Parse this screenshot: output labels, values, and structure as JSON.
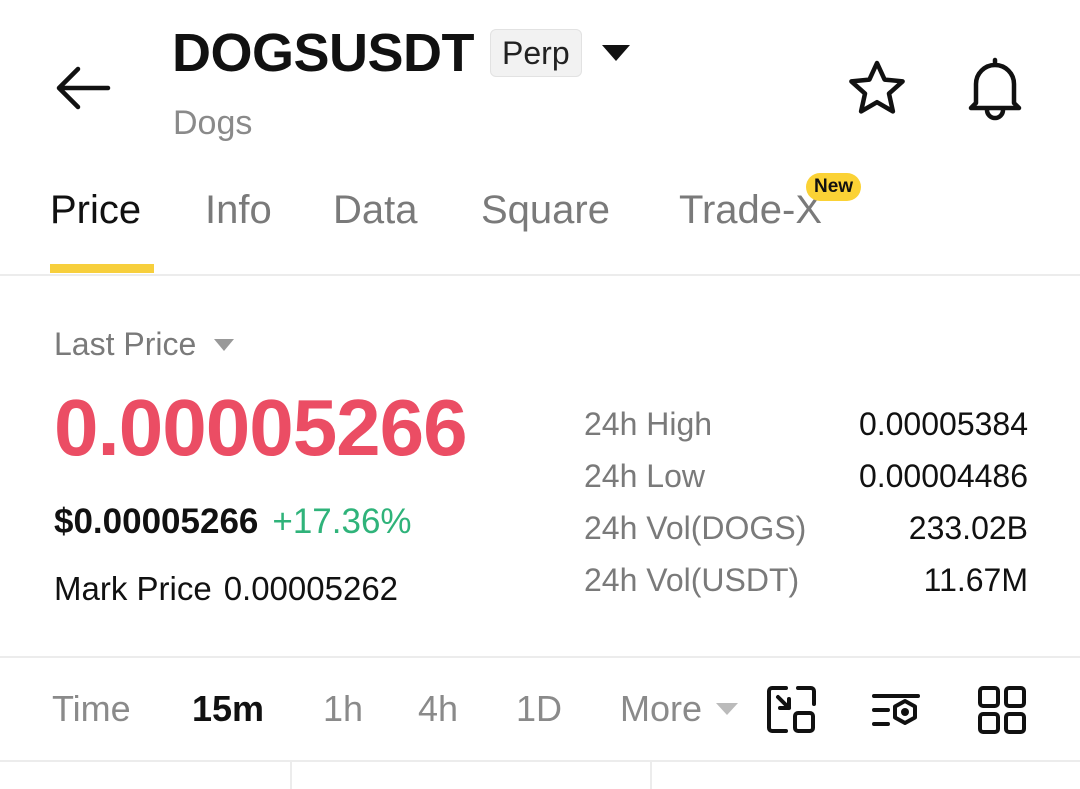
{
  "header": {
    "symbol": "DOGSUSDT",
    "contract_type": "Perp",
    "base_name": "Dogs"
  },
  "tabs": [
    {
      "label": "Price"
    },
    {
      "label": "Info"
    },
    {
      "label": "Data"
    },
    {
      "label": "Square"
    },
    {
      "label": "Trade-X"
    }
  ],
  "tab_badge": "New",
  "price": {
    "selector_label": "Last Price",
    "last_price": "0.00005266",
    "usd_price": "$0.00005266",
    "change_pct": "+17.36%",
    "mark_label": "Mark Price",
    "mark_value": "0.00005262"
  },
  "stats": [
    {
      "label": "24h High",
      "value": "0.00005384"
    },
    {
      "label": "24h Low",
      "value": "0.00004486"
    },
    {
      "label": "24h Vol(DOGS)",
      "value": "233.02B"
    },
    {
      "label": "24h Vol(USDT)",
      "value": "11.67M"
    }
  ],
  "timebar": {
    "time_label": "Time",
    "intervals": [
      "15m",
      "1h",
      "4h",
      "1D"
    ],
    "more_label": "More"
  },
  "colors": {
    "price_down_red": "#eb4d64",
    "change_up_green": "#2fb37a",
    "accent_yellow": "#f7cf3c"
  },
  "icons": {
    "back": "arrow-left-icon",
    "favorite": "star-icon",
    "alert": "bell-icon",
    "fullscreen": "expand-chart-icon",
    "indicators": "indicator-settings-icon",
    "layout": "grid-layout-icon"
  }
}
